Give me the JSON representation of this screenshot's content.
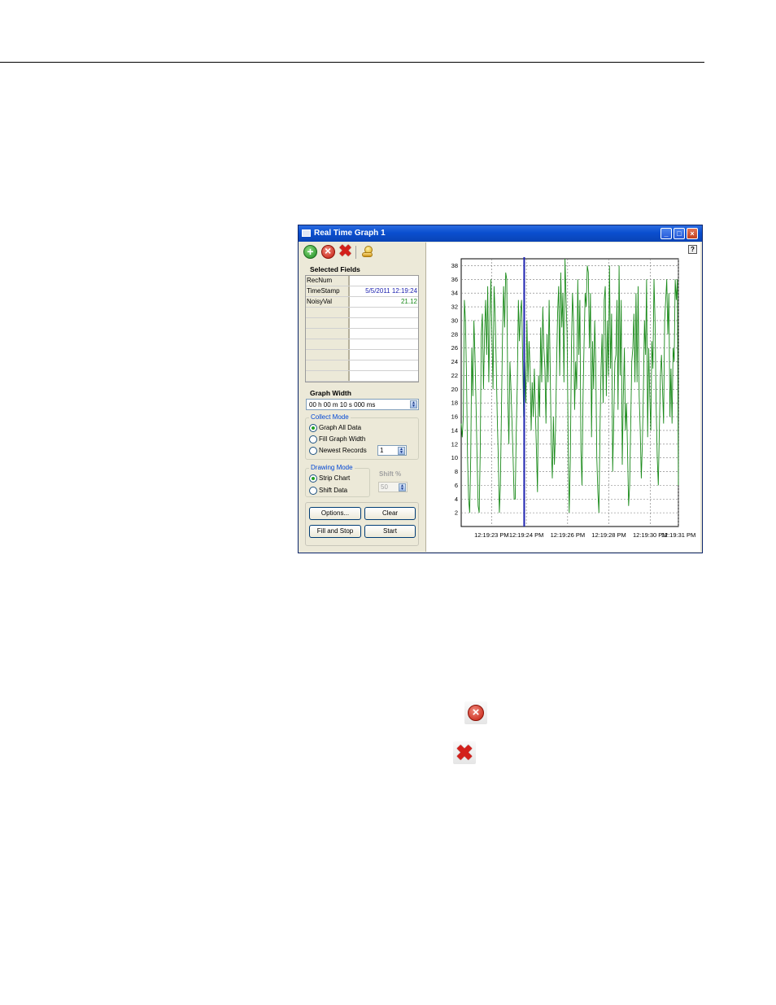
{
  "window": {
    "title": "Real Time Graph 1",
    "controls": {
      "minimize": "_",
      "maximize": "□",
      "close": "×"
    }
  },
  "toolbar": {
    "icons": [
      "add-icon",
      "remove-icon",
      "remove-all-icon",
      "pin-icon"
    ]
  },
  "selected_fields": {
    "title": "Selected Fields",
    "rows": [
      {
        "name": "RecNum",
        "value": ""
      },
      {
        "name": "TimeStamp",
        "value": "5/5/2011 12:19:24"
      },
      {
        "name": "NoisyVal",
        "value": "21.12"
      },
      {
        "name": "",
        "value": ""
      },
      {
        "name": "",
        "value": ""
      },
      {
        "name": "",
        "value": ""
      },
      {
        "name": "",
        "value": ""
      },
      {
        "name": "",
        "value": ""
      },
      {
        "name": "",
        "value": ""
      },
      {
        "name": "",
        "value": ""
      }
    ],
    "colors": {
      "timestamp": "#1f24b0",
      "value": "#1a8a1a"
    }
  },
  "graph_width": {
    "title": "Graph Width",
    "value": "00 h 00 m 10 s 000 ms"
  },
  "collect_mode": {
    "title": "Collect Mode",
    "options": [
      "Graph All Data",
      "Fill Graph Width",
      "Newest Records"
    ],
    "selected": "Graph All Data",
    "records_value": "1"
  },
  "drawing_mode": {
    "title": "Drawing Mode",
    "options": [
      "Strip Chart",
      "Shift Data"
    ],
    "selected": "Strip Chart",
    "shift_label": "Shift %",
    "shift_value": "50"
  },
  "buttons": {
    "options": "Options...",
    "clear": "Clear",
    "fill_and_stop": "Fill and Stop",
    "start": "Start"
  },
  "help_label": "?",
  "chart_data": {
    "type": "line",
    "ylim": [
      0,
      39
    ],
    "yticks": [
      2,
      4,
      6,
      8,
      10,
      12,
      14,
      16,
      18,
      20,
      22,
      24,
      26,
      28,
      30,
      32,
      34,
      36,
      38
    ],
    "xticks": [
      "12:19:23 PM",
      "12:19:24 PM",
      "12:19:26 PM",
      "12:19:28 PM",
      "12:19:30 PM",
      "12:19:31 PM"
    ],
    "xlim": [
      0,
      10
    ],
    "xtick_positions": [
      1.4,
      3.0,
      4.9,
      6.8,
      8.7,
      10.0
    ],
    "grid": true,
    "cursor_x": 2.9,
    "series": [
      {
        "color": "#1a8a1a",
        "values": [
          15,
          13,
          16,
          33,
          30,
          22,
          10,
          4,
          2,
          10,
          26,
          19,
          30,
          25,
          18,
          10,
          3,
          2,
          11,
          28,
          31,
          20,
          28,
          33,
          25,
          35,
          21,
          30,
          36,
          28,
          20,
          35,
          31,
          24,
          16,
          10,
          2,
          6,
          17,
          28,
          35,
          29,
          37,
          36,
          19,
          12,
          24,
          20,
          15,
          10,
          4,
          4,
          14,
          21,
          33,
          27,
          31,
          33,
          25,
          16,
          24,
          18,
          30,
          21,
          27,
          23,
          14,
          21,
          16,
          23,
          17,
          11,
          5,
          22,
          16,
          29,
          21,
          32,
          26,
          23,
          15,
          28,
          21,
          33,
          23,
          12,
          7,
          16,
          9,
          14,
          23,
          31,
          35,
          22,
          37,
          29,
          34,
          21,
          39,
          33,
          28,
          12,
          2,
          10,
          26,
          34,
          30,
          17,
          24,
          20,
          36,
          25,
          33,
          11,
          6,
          19,
          27,
          34,
          32,
          38,
          37,
          26,
          34,
          13,
          27,
          20,
          30,
          24,
          10,
          5,
          2,
          14,
          23,
          28,
          18,
          33,
          35,
          19,
          30,
          22,
          38,
          23,
          31,
          8,
          16,
          24,
          25,
          33,
          17,
          38,
          22,
          33,
          9,
          19,
          26,
          14,
          18,
          11,
          3,
          6,
          15,
          24,
          26,
          31,
          21,
          34,
          21,
          35,
          19,
          14,
          7,
          12,
          20,
          30,
          25,
          36,
          13,
          26,
          19,
          14,
          27,
          23,
          36,
          30,
          18,
          10,
          6,
          14,
          22,
          25,
          20,
          15,
          30,
          33,
          36,
          28,
          34,
          16,
          23,
          15,
          26,
          24,
          36,
          33,
          36,
          6
        ]
      }
    ]
  }
}
